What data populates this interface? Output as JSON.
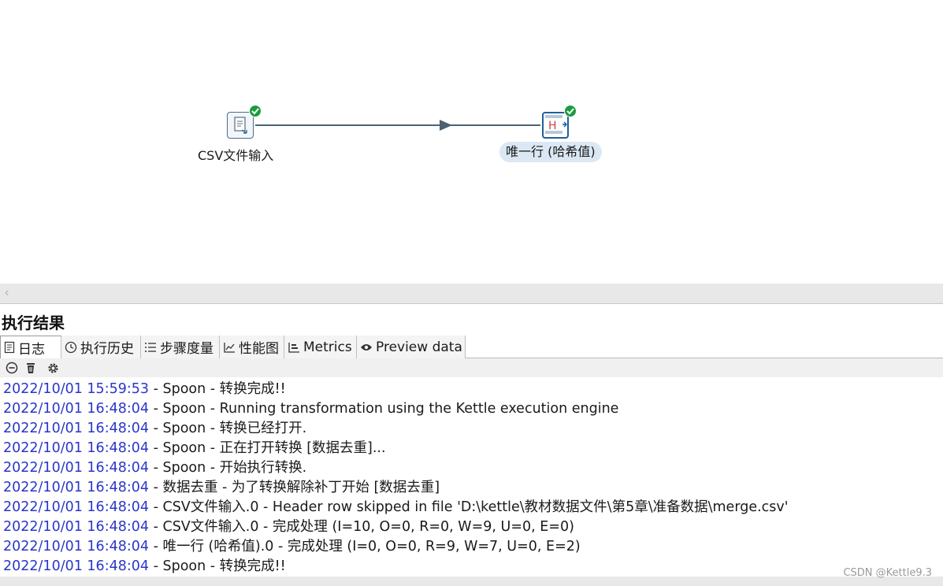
{
  "canvas": {
    "steps": [
      {
        "label": "CSV文件输入",
        "status": "success"
      },
      {
        "label": "唯一行 (哈希值)",
        "status": "success"
      }
    ]
  },
  "results": {
    "title": "执行结果",
    "tabs": [
      {
        "label": "日志",
        "icon": "log-icon",
        "active": true
      },
      {
        "label": "执行历史",
        "icon": "history-icon",
        "active": false
      },
      {
        "label": "步骤度量",
        "icon": "step-metrics-icon",
        "active": false
      },
      {
        "label": "性能图",
        "icon": "performance-chart-icon",
        "active": false
      },
      {
        "label": "Metrics",
        "icon": "metrics-icon",
        "active": false
      },
      {
        "label": "Preview data",
        "icon": "preview-eye-icon",
        "active": false
      }
    ],
    "toolbar": {
      "icons": [
        "stop-icon",
        "clear-log-icon",
        "settings-gear-icon"
      ]
    },
    "log_lines": [
      {
        "ts": "2022/10/01 15:59:53",
        "msg": " - Spoon - 转换完成!!"
      },
      {
        "ts": "2022/10/01 16:48:04",
        "msg": " - Spoon - Running transformation using the Kettle execution engine"
      },
      {
        "ts": "2022/10/01 16:48:04",
        "msg": " - Spoon - 转换已经打开."
      },
      {
        "ts": "2022/10/01 16:48:04",
        "msg": " - Spoon - 正在打开转换 [数据去重]..."
      },
      {
        "ts": "2022/10/01 16:48:04",
        "msg": " - Spoon - 开始执行转换."
      },
      {
        "ts": "2022/10/01 16:48:04",
        "msg": " - 数据去重 - 为了转换解除补丁开始  [数据去重]"
      },
      {
        "ts": "2022/10/01 16:48:04",
        "msg": " - CSV文件输入.0 - Header row skipped in file 'D:\\kettle\\教材数据文件\\第5章\\准备数据\\merge.csv'"
      },
      {
        "ts": "2022/10/01 16:48:04",
        "msg": " - CSV文件输入.0 - 完成处理 (I=10, O=0, R=0, W=9, U=0, E=0)"
      },
      {
        "ts": "2022/10/01 16:48:04",
        "msg": " - 唯一行 (哈希值).0 - 完成处理 (I=0, O=0, R=9, W=7, U=0, E=2)"
      },
      {
        "ts": "2022/10/01 16:48:04",
        "msg": " - Spoon - 转换完成!!"
      }
    ]
  },
  "watermark": "CSDN @Kettle9.3",
  "colors": {
    "timestamp": "#2a36c8",
    "hop": "#4a6274",
    "success": "#1a9c3e",
    "selected_step_bg": "#dbe8f4"
  }
}
